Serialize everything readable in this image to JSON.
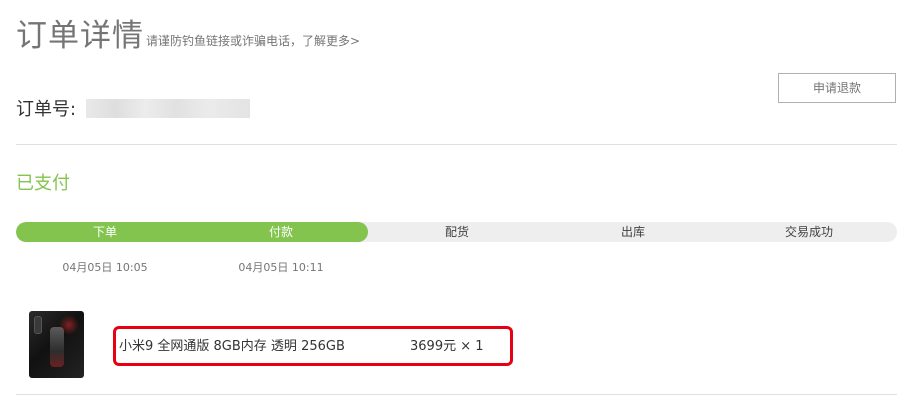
{
  "page": {
    "title": "订单详情",
    "tip": "请谨防钓鱼链接或诈骗电话，了解更多>"
  },
  "order": {
    "number_label": "订单号:",
    "refund_button": "申请退款",
    "status": "已支付"
  },
  "progress": {
    "completed_fraction": 0.4,
    "fill_color": "#83c44e",
    "steps": [
      {
        "label": "下单",
        "time": "04月05日 10:05",
        "done": true
      },
      {
        "label": "付款",
        "time": "04月05日 10:11",
        "done": true
      },
      {
        "label": "配货",
        "time": "",
        "done": false
      },
      {
        "label": "出库",
        "time": "",
        "done": false
      },
      {
        "label": "交易成功",
        "time": "",
        "done": false
      }
    ]
  },
  "items": [
    {
      "name": "小米9 全网通版 8GB内存 透明 256GB",
      "price_qty": "3699元 × 1",
      "image": "phone-product-image"
    }
  ],
  "colors": {
    "accent_green": "#83c44e",
    "highlight_red": "#e60012"
  }
}
